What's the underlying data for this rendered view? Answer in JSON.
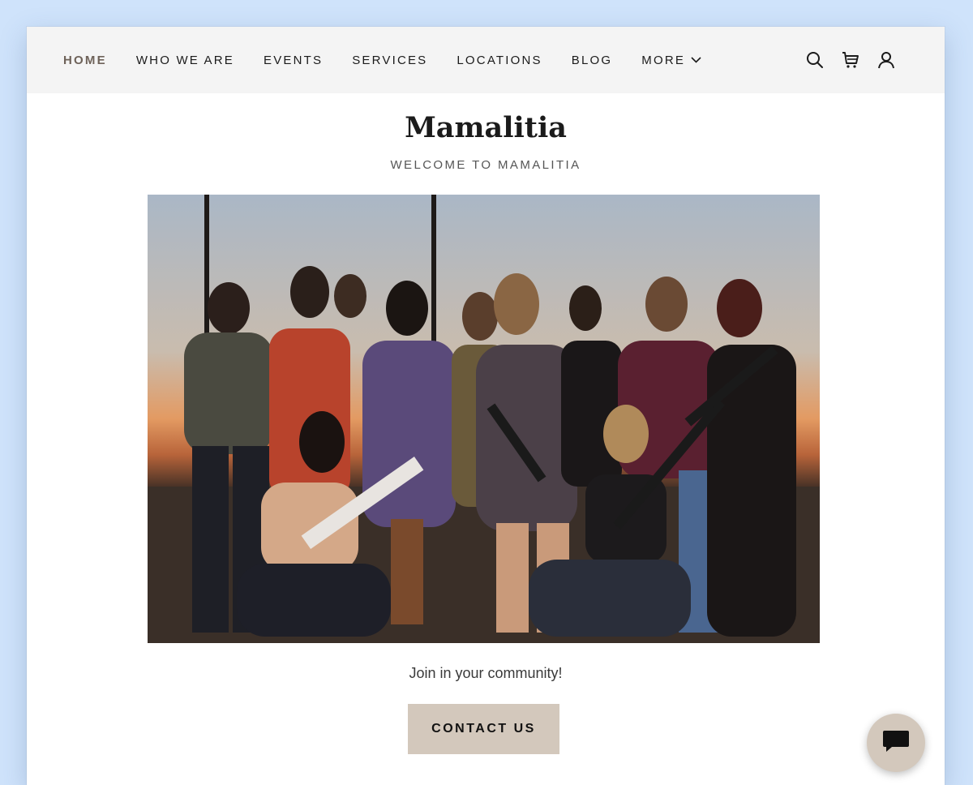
{
  "nav": {
    "links": [
      {
        "label": "HOME",
        "active": true
      },
      {
        "label": "WHO WE ARE"
      },
      {
        "label": "EVENTS"
      },
      {
        "label": "SERVICES"
      },
      {
        "label": "LOCATIONS"
      },
      {
        "label": "BLOG"
      },
      {
        "label": "MORE",
        "dropdown": true
      }
    ],
    "icons": [
      "search-icon",
      "cart-icon",
      "account-icon"
    ]
  },
  "hero": {
    "title": "Mamalitia",
    "tagline": "WELCOME TO MAMALITIA",
    "image_subject": "group-photo"
  },
  "cta": {
    "text": "Join in your community!",
    "button_label": "CONTACT US"
  },
  "chat": {
    "icon": "chat-bubble-icon"
  },
  "colors": {
    "accent": "#d3c8bc",
    "active_nav": "#6e6259",
    "nav_bg": "#f4f4f4",
    "backdrop": "#cfe3fb"
  }
}
